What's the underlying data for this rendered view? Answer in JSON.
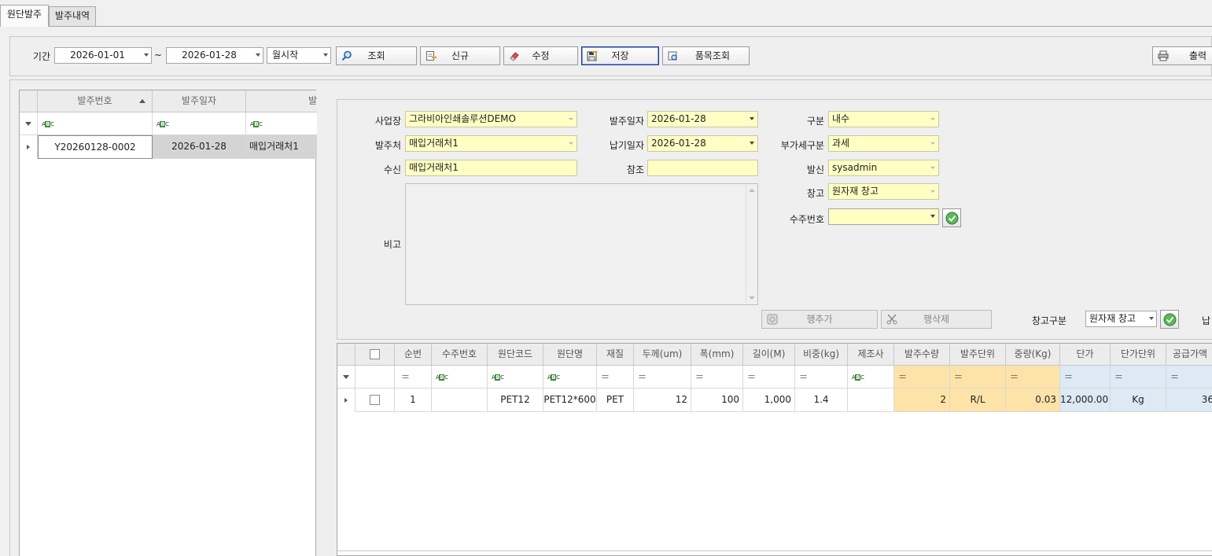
{
  "tabs": [
    "원단발주",
    "발주내역"
  ],
  "toolbar": {
    "period_label": "기간",
    "date_from": "2026-01-01",
    "date_sep": "~",
    "date_to": "2026-01-28",
    "week_start": "월시작",
    "search": "조회",
    "new": "신규",
    "edit": "수정",
    "save": "저장",
    "item_search": "품목조회",
    "print": "출력"
  },
  "list": {
    "headers": [
      "발주번호",
      "발주일자",
      "발"
    ],
    "rows": [
      {
        "no": "Y20260128-0002",
        "date": "2026-01-28",
        "vendor": "매입거래처1"
      }
    ]
  },
  "form": {
    "site_label": "사업장",
    "site": "그라비아인쇄솔루션DEMO",
    "order_date_label": "발주일자",
    "order_date": "2026-01-28",
    "type_label": "구분",
    "type": "내수",
    "vendor_label": "발주처",
    "vendor": "매입거래처1",
    "due_date_label": "납기일자",
    "due_date": "2026-01-28",
    "vat_label": "부가세구분",
    "vat": "과세",
    "to_label": "수신",
    "to": "매입거래처1",
    "ref_label": "참조",
    "ref": "",
    "from_label": "발신",
    "from": "sysadmin",
    "wh_label": "창고",
    "wh": "원자재 창고",
    "so_label": "수주번호",
    "so": "",
    "memo_label": "비고",
    "memo": ""
  },
  "detail_toolbar": {
    "add_row": "행추가",
    "del_row": "행삭제",
    "wh_type_label": "창고구분",
    "wh_type": "원자재 창고",
    "due_label": "납"
  },
  "detail": {
    "headers": [
      "순번",
      "수주번호",
      "원단코드",
      "원단명",
      "재질",
      "두께(um)",
      "폭(mm)",
      "길이(M)",
      "비중(kg)",
      "제조사",
      "발주수량",
      "발주단위",
      "중량(Kg)",
      "단가",
      "단가단위",
      "공급가액"
    ],
    "rows": [
      {
        "seq": "1",
        "so": "",
        "code": "PET12",
        "name": "PET12*600",
        "material": "PET",
        "thick": "12",
        "width": "100",
        "length": "1,000",
        "gravity": "1.4",
        "maker": "",
        "qty": "2",
        "unit": "R/L",
        "weight": "0.03",
        "price": "12,000.00",
        "price_unit": "Kg",
        "amount": "36"
      }
    ]
  },
  "colors": {
    "yellow_field": "#ffffc4",
    "orange_col": "#fde3a7",
    "blue_col": "#dde9f5",
    "selected_cell": "#d4d4d4"
  }
}
